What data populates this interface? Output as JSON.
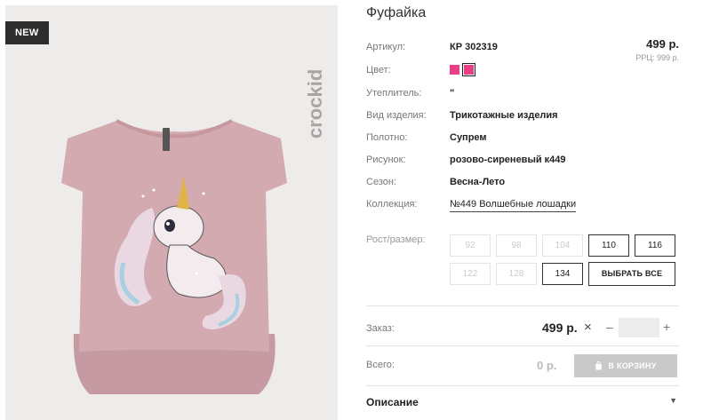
{
  "badge": "NEW",
  "brand_logo": "crockid",
  "product": {
    "title": "Фуфайка",
    "article_label": "Артикул:",
    "article": "КР 302319",
    "price": "499 р.",
    "rrp": "РРЦ: 999 р.",
    "color_label": "Цвет:",
    "swatch_color": "#ec3e86",
    "insulation_label": "Утеплитель:",
    "insulation": "\"",
    "type_label": "Вид изделия:",
    "type": "Трикотажные изделия",
    "fabric_label": "Полотно:",
    "fabric": "Супрем",
    "pattern_label": "Рисунок:",
    "pattern": "розово-сиреневый к449",
    "season_label": "Сезон:",
    "season": "Весна-Лето",
    "collection_label": "Коллекция:",
    "collection": "№449 Волшебные лошадки"
  },
  "sizes": {
    "label": "Рост/размер:",
    "items": [
      {
        "label": "92",
        "available": false
      },
      {
        "label": "98",
        "available": false
      },
      {
        "label": "104",
        "available": false
      },
      {
        "label": "110",
        "available": true
      },
      {
        "label": "116",
        "available": true
      },
      {
        "label": "122",
        "available": false
      },
      {
        "label": "128",
        "available": false
      },
      {
        "label": "134",
        "available": true
      }
    ],
    "select_all": "ВЫБРАТЬ ВСЕ"
  },
  "order": {
    "label": "Заказ:",
    "price": "499 р.",
    "times": "×",
    "minus": "–",
    "qty": "",
    "plus": "+"
  },
  "total": {
    "label": "Всего:",
    "value": "0 р.",
    "cart_button": "В КОРЗИНУ"
  },
  "description": {
    "label": "Описание",
    "arrow": "▼"
  }
}
